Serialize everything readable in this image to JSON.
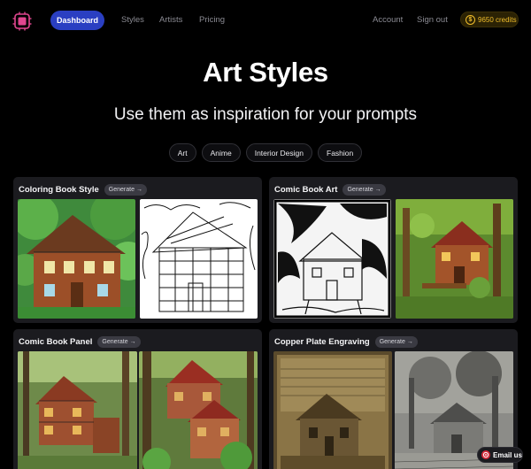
{
  "nav": {
    "dashboard": "Dashboard",
    "styles": "Styles",
    "artists": "Artists",
    "pricing": "Pricing",
    "account": "Account",
    "sign_out": "Sign out",
    "credits": "9650 credits"
  },
  "hero": {
    "title": "Art Styles",
    "subtitle": "Use them as inspiration for your prompts"
  },
  "filters": [
    "Art",
    "Anime",
    "Interior Design",
    "Fashion"
  ],
  "cards": [
    {
      "title": "Coloring Book Style",
      "button": "Generate"
    },
    {
      "title": "Comic Book Art",
      "button": "Generate"
    },
    {
      "title": "Comic Book Panel",
      "button": "Generate"
    },
    {
      "title": "Copper Plate Engraving",
      "button": "Generate"
    }
  ],
  "email_button": "Email us",
  "colors": {
    "accent": "#2a3fc2",
    "credits": "#f1be2c",
    "card_bg": "#1b1b1f",
    "email": "#d62b3a"
  }
}
